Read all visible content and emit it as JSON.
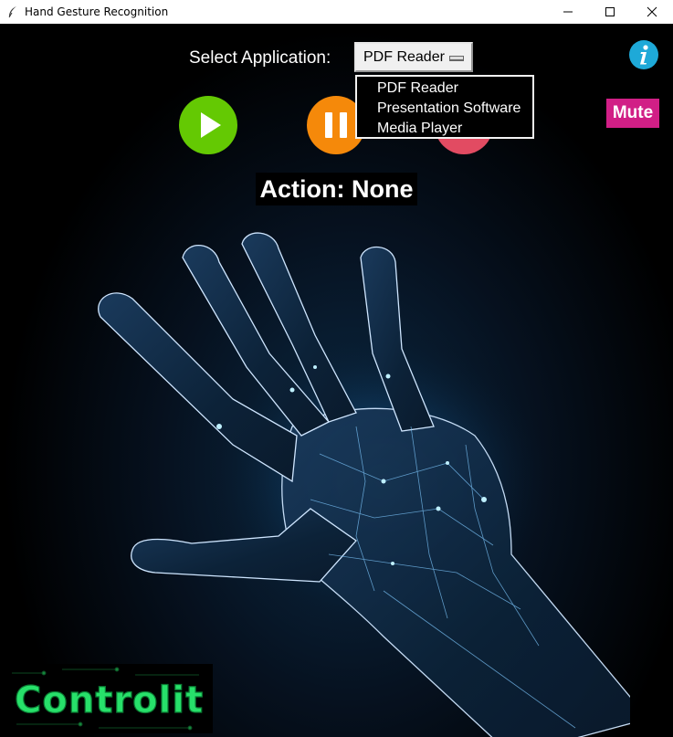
{
  "window": {
    "title": "Hand Gesture Recognition",
    "controls": [
      "minimize",
      "maximize",
      "close"
    ]
  },
  "app_select": {
    "label": "Select Application:",
    "value": "PDF Reader",
    "options": [
      "PDF Reader",
      "Presentation Software",
      "Media Player"
    ],
    "expanded": true
  },
  "controls": {
    "play_color": "#64c903",
    "pause_color": "#f5890a",
    "stop_color": "#e24b62",
    "mute_label": "Mute",
    "mute_color": "#d11f86",
    "info_color": "#1ea9d8"
  },
  "status": {
    "action_text": "Action: None"
  },
  "logo": {
    "text": "Controlit"
  }
}
